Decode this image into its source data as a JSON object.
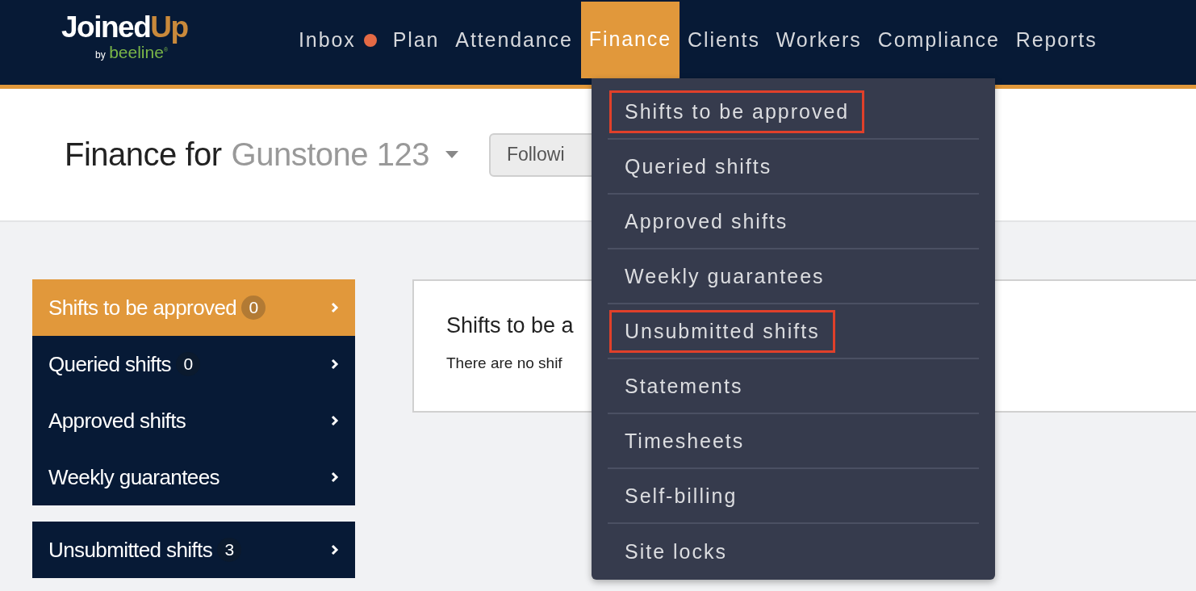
{
  "logo": {
    "word": "Joined",
    "accent": "Up",
    "byline": "by",
    "brand": "beeline$^{®}$"
  },
  "nav": [
    {
      "label": "Inbox",
      "selected": false,
      "dot": true
    },
    {
      "label": "Plan",
      "selected": false,
      "dot": false
    },
    {
      "label": "Attendance",
      "selected": false,
      "dot": false
    },
    {
      "label": "Finance",
      "selected": true,
      "dot": false
    },
    {
      "label": "Clients",
      "selected": false,
      "dot": false
    },
    {
      "label": "Workers",
      "selected": false,
      "dot": false
    },
    {
      "label": "Compliance",
      "selected": false,
      "dot": false
    },
    {
      "label": "Reports",
      "selected": false,
      "dot": false
    }
  ],
  "page_title": {
    "prefix": "Finance for",
    "client": "Gunstone 123"
  },
  "following_button": "Followi",
  "sidebar": [
    {
      "items": [
        {
          "label": "Shifts to be approved",
          "count": "0",
          "selected": true
        },
        {
          "label": "Queried shifts",
          "count": "0",
          "selected": false
        },
        {
          "label": "Approved shifts",
          "selected": false
        },
        {
          "label": "Weekly guarantees",
          "selected": false
        }
      ]
    },
    {
      "items": [
        {
          "label": "Unsubmitted shifts",
          "count": "3",
          "selected": false
        }
      ]
    }
  ],
  "content": {
    "heading": "Shifts to be a",
    "message": "There are no shif"
  },
  "finance_menu": [
    {
      "label": "Shifts to be approved",
      "highlighted": true
    },
    {
      "label": "Queried shifts",
      "highlighted": false
    },
    {
      "label": "Approved shifts",
      "highlighted": false
    },
    {
      "label": "Weekly guarantees",
      "highlighted": false
    },
    {
      "label": "Unsubmitted shifts",
      "highlighted": true
    },
    {
      "label": "Statements",
      "highlighted": false
    },
    {
      "label": "Timesheets",
      "highlighted": false
    },
    {
      "label": "Self-billing",
      "highlighted": false
    },
    {
      "label": "Site locks",
      "highlighted": false
    }
  ]
}
